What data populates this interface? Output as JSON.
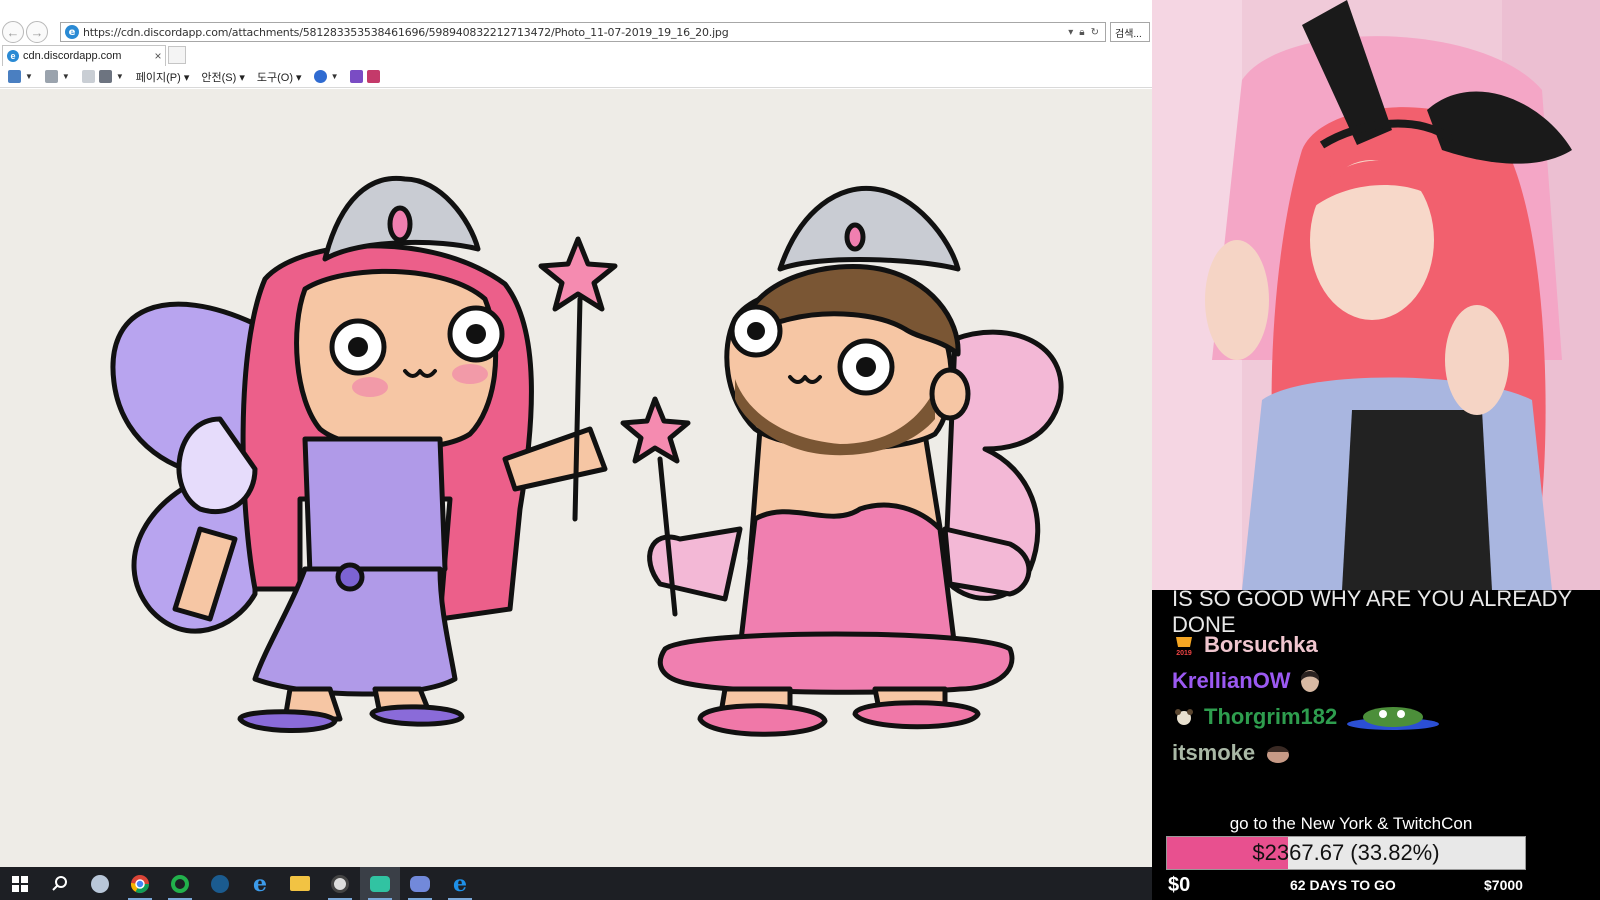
{
  "browser": {
    "url": "https://cdn.discordapp.com/attachments/581283353538461696/598940832212713472/Photo_11-07-2019_19_16_20.jpg",
    "search_label": "검색...",
    "tab_title": "cdn.discordapp.com",
    "tab_close": "×",
    "menus": {
      "page": "페이지(P)",
      "safety": "안전(S)",
      "tools": "도구(O)"
    },
    "nav_back_glyph": "←",
    "nav_forward_glyph": "→"
  },
  "artwork": {
    "description_icon": "drawing-image",
    "palette": {
      "paper": "#eeece7",
      "wing_left": "#b8a4ef",
      "wing_right": "#f3b8d6",
      "dress_left": "#b09ae8",
      "dress_right": "#f07fb0",
      "hair_pink": "#ec5f8a",
      "skin": "#f6c6a4",
      "beard": "#7a5634",
      "tiara": "#c9ccd3",
      "star": "#f58bb0"
    }
  },
  "taskbar": {
    "icons": [
      "windows-start-icon",
      "search-icon",
      "cortana-app-icon",
      "chrome-icon",
      "android-icon",
      "steam-icon",
      "edge-icon",
      "file-explorer-icon",
      "obs-icon",
      "streamlabs-icon",
      "discord-icon",
      "internet-explorer-icon"
    ]
  },
  "stream": {
    "chat_partial": "IS SO GOOD WHY ARE YOU ALREADY DONE",
    "chat": [
      {
        "user": "Borsuchka",
        "color": "#f0c6cf",
        "badge": "2019-badge"
      },
      {
        "user": "KrellianOW",
        "color": "#9b59f2",
        "badge": ""
      },
      {
        "user": "Thorgrim182",
        "color": "#2e9d4e",
        "badge": "dog-badge"
      },
      {
        "user": "itsmoke",
        "color": "#a9b8a6",
        "badge": ""
      }
    ],
    "badge_year": "2019",
    "goal": {
      "title": "go to the New York & TwitchCon",
      "amount_text": "$2367.67 (33.82%)",
      "progress_pct": 33.82,
      "min_label": "$0",
      "days_label": "62 DAYS TO GO",
      "max_label": "$7000",
      "bar_color": "#e8508f"
    }
  }
}
